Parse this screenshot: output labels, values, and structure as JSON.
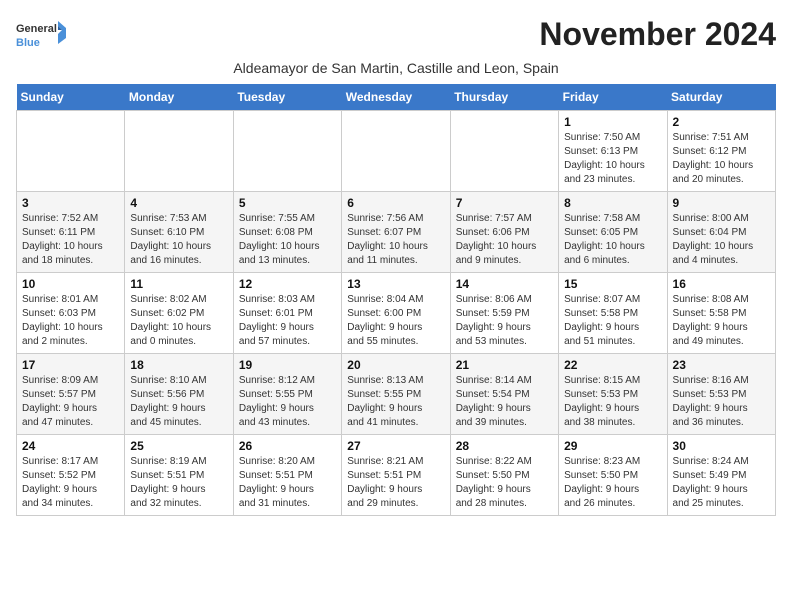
{
  "logo": {
    "line1": "General",
    "line2": "Blue"
  },
  "title": "November 2024",
  "subtitle": "Aldeamayor de San Martin, Castille and Leon, Spain",
  "days_of_week": [
    "Sunday",
    "Monday",
    "Tuesday",
    "Wednesday",
    "Thursday",
    "Friday",
    "Saturday"
  ],
  "weeks": [
    [
      {
        "day": "",
        "info": ""
      },
      {
        "day": "",
        "info": ""
      },
      {
        "day": "",
        "info": ""
      },
      {
        "day": "",
        "info": ""
      },
      {
        "day": "",
        "info": ""
      },
      {
        "day": "1",
        "info": "Sunrise: 7:50 AM\nSunset: 6:13 PM\nDaylight: 10 hours\nand 23 minutes."
      },
      {
        "day": "2",
        "info": "Sunrise: 7:51 AM\nSunset: 6:12 PM\nDaylight: 10 hours\nand 20 minutes."
      }
    ],
    [
      {
        "day": "3",
        "info": "Sunrise: 7:52 AM\nSunset: 6:11 PM\nDaylight: 10 hours\nand 18 minutes."
      },
      {
        "day": "4",
        "info": "Sunrise: 7:53 AM\nSunset: 6:10 PM\nDaylight: 10 hours\nand 16 minutes."
      },
      {
        "day": "5",
        "info": "Sunrise: 7:55 AM\nSunset: 6:08 PM\nDaylight: 10 hours\nand 13 minutes."
      },
      {
        "day": "6",
        "info": "Sunrise: 7:56 AM\nSunset: 6:07 PM\nDaylight: 10 hours\nand 11 minutes."
      },
      {
        "day": "7",
        "info": "Sunrise: 7:57 AM\nSunset: 6:06 PM\nDaylight: 10 hours\nand 9 minutes."
      },
      {
        "day": "8",
        "info": "Sunrise: 7:58 AM\nSunset: 6:05 PM\nDaylight: 10 hours\nand 6 minutes."
      },
      {
        "day": "9",
        "info": "Sunrise: 8:00 AM\nSunset: 6:04 PM\nDaylight: 10 hours\nand 4 minutes."
      }
    ],
    [
      {
        "day": "10",
        "info": "Sunrise: 8:01 AM\nSunset: 6:03 PM\nDaylight: 10 hours\nand 2 minutes."
      },
      {
        "day": "11",
        "info": "Sunrise: 8:02 AM\nSunset: 6:02 PM\nDaylight: 10 hours\nand 0 minutes."
      },
      {
        "day": "12",
        "info": "Sunrise: 8:03 AM\nSunset: 6:01 PM\nDaylight: 9 hours\nand 57 minutes."
      },
      {
        "day": "13",
        "info": "Sunrise: 8:04 AM\nSunset: 6:00 PM\nDaylight: 9 hours\nand 55 minutes."
      },
      {
        "day": "14",
        "info": "Sunrise: 8:06 AM\nSunset: 5:59 PM\nDaylight: 9 hours\nand 53 minutes."
      },
      {
        "day": "15",
        "info": "Sunrise: 8:07 AM\nSunset: 5:58 PM\nDaylight: 9 hours\nand 51 minutes."
      },
      {
        "day": "16",
        "info": "Sunrise: 8:08 AM\nSunset: 5:58 PM\nDaylight: 9 hours\nand 49 minutes."
      }
    ],
    [
      {
        "day": "17",
        "info": "Sunrise: 8:09 AM\nSunset: 5:57 PM\nDaylight: 9 hours\nand 47 minutes."
      },
      {
        "day": "18",
        "info": "Sunrise: 8:10 AM\nSunset: 5:56 PM\nDaylight: 9 hours\nand 45 minutes."
      },
      {
        "day": "19",
        "info": "Sunrise: 8:12 AM\nSunset: 5:55 PM\nDaylight: 9 hours\nand 43 minutes."
      },
      {
        "day": "20",
        "info": "Sunrise: 8:13 AM\nSunset: 5:55 PM\nDaylight: 9 hours\nand 41 minutes."
      },
      {
        "day": "21",
        "info": "Sunrise: 8:14 AM\nSunset: 5:54 PM\nDaylight: 9 hours\nand 39 minutes."
      },
      {
        "day": "22",
        "info": "Sunrise: 8:15 AM\nSunset: 5:53 PM\nDaylight: 9 hours\nand 38 minutes."
      },
      {
        "day": "23",
        "info": "Sunrise: 8:16 AM\nSunset: 5:53 PM\nDaylight: 9 hours\nand 36 minutes."
      }
    ],
    [
      {
        "day": "24",
        "info": "Sunrise: 8:17 AM\nSunset: 5:52 PM\nDaylight: 9 hours\nand 34 minutes."
      },
      {
        "day": "25",
        "info": "Sunrise: 8:19 AM\nSunset: 5:51 PM\nDaylight: 9 hours\nand 32 minutes."
      },
      {
        "day": "26",
        "info": "Sunrise: 8:20 AM\nSunset: 5:51 PM\nDaylight: 9 hours\nand 31 minutes."
      },
      {
        "day": "27",
        "info": "Sunrise: 8:21 AM\nSunset: 5:51 PM\nDaylight: 9 hours\nand 29 minutes."
      },
      {
        "day": "28",
        "info": "Sunrise: 8:22 AM\nSunset: 5:50 PM\nDaylight: 9 hours\nand 28 minutes."
      },
      {
        "day": "29",
        "info": "Sunrise: 8:23 AM\nSunset: 5:50 PM\nDaylight: 9 hours\nand 26 minutes."
      },
      {
        "day": "30",
        "info": "Sunrise: 8:24 AM\nSunset: 5:49 PM\nDaylight: 9 hours\nand 25 minutes."
      }
    ]
  ]
}
